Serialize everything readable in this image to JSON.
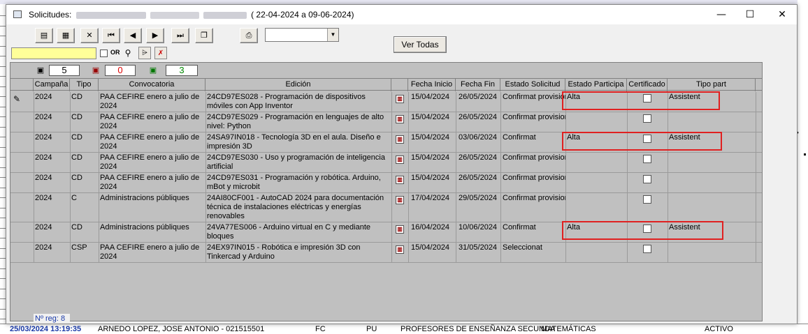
{
  "window": {
    "title_prefix": "Solicitudes:",
    "title_range": "( 22-04-2024 a  09-06-2024)",
    "minimize": "—",
    "maximize": "☐",
    "close": "✕"
  },
  "toolbar": {
    "icons": [
      "form-icon",
      "table-view-icon",
      "delete-icon",
      "first-record-icon",
      "previous-record-icon",
      "next-record-icon",
      "last-record-icon",
      "copy-icon",
      "print-icon"
    ],
    "ver_todas_label": "Ver Todas",
    "combo_value": "",
    "search_value": "",
    "or_label": "OR"
  },
  "counters": {
    "count1": "5",
    "count2": "0",
    "count3": "3"
  },
  "columns": [
    "Campaña",
    "Tipo",
    "Convocatoria",
    "Edición",
    "Fecha Inicio",
    "Fecha Fin",
    "Estado Solicitud",
    "Estado Participa",
    "Certificado",
    "Tipo part"
  ],
  "rows": [
    {
      "campana": "2024",
      "tipo": "CD",
      "convocatoria": "PAA CEFIRE enero a julio de 2024",
      "edicion": "24CD97ES028 - Programación de dispositivos móviles con App Inventor",
      "fecha_inicio": "15/04/2024",
      "fecha_fin": "26/05/2024",
      "estado_solicitud": "Confirmat provisional",
      "estado_participa": "Alta",
      "tipo_part": "Assistent"
    },
    {
      "campana": "2024",
      "tipo": "CD",
      "convocatoria": "PAA CEFIRE enero a julio de 2024",
      "edicion": "24CD97ES029 - Programación en lenguajes de alto nivel: Python",
      "fecha_inicio": "15/04/2024",
      "fecha_fin": "26/05/2024",
      "estado_solicitud": "Confirmat provisional",
      "estado_participa": "",
      "tipo_part": ""
    },
    {
      "campana": "2024",
      "tipo": "CD",
      "convocatoria": "PAA CEFIRE enero a julio de 2024",
      "edicion": "24SA97IN018 - Tecnología 3D en el aula. Diseño e impresión 3D",
      "fecha_inicio": "15/04/2024",
      "fecha_fin": "03/06/2024",
      "estado_solicitud": "Confirmat",
      "estado_participa": "Alta",
      "tipo_part": "Assistent"
    },
    {
      "campana": "2024",
      "tipo": "CD",
      "convocatoria": "PAA CEFIRE enero a julio de 2024",
      "edicion": "24CD97ES030 - Uso y programación de inteligencia artificial",
      "fecha_inicio": "15/04/2024",
      "fecha_fin": "26/05/2024",
      "estado_solicitud": "Confirmat provisional",
      "estado_participa": "",
      "tipo_part": ""
    },
    {
      "campana": "2024",
      "tipo": "CD",
      "convocatoria": "PAA CEFIRE enero a julio de 2024",
      "edicion": "24CD97ES031 - Programación y robótica. Arduino, mBot y microbit",
      "fecha_inicio": "15/04/2024",
      "fecha_fin": "26/05/2024",
      "estado_solicitud": "Confirmat provisional",
      "estado_participa": "",
      "tipo_part": ""
    },
    {
      "campana": "2024",
      "tipo": "C",
      "convocatoria": "Administracions públiques",
      "edicion": "24AI80CF001 - AutoCAD 2024 para documentación técnica de instalaciones eléctricas y energías renovables",
      "fecha_inicio": "17/04/2024",
      "fecha_fin": "29/05/2024",
      "estado_solicitud": "Confirmat provisional",
      "estado_participa": "",
      "tipo_part": ""
    },
    {
      "campana": "2024",
      "tipo": "CD",
      "convocatoria": "Administracions públiques",
      "edicion": "24VA77ES006 - Arduino virtual en C y mediante bloques",
      "fecha_inicio": "16/04/2024",
      "fecha_fin": "10/06/2024",
      "estado_solicitud": "Confirmat",
      "estado_participa": "Alta",
      "tipo_part": "Assistent"
    },
    {
      "campana": "2024",
      "tipo": "CSP",
      "convocatoria": "PAA CEFIRE enero a julio de 2024",
      "edicion": "24EX97IN015 - Robótica e impresión 3D con Tinkercad y Arduino",
      "fecha_inicio": "15/04/2024",
      "fecha_fin": "31/05/2024",
      "estado_solicitud": "Seleccionat",
      "estado_participa": "",
      "tipo_part": ""
    }
  ],
  "footer": {
    "nreg": "Nº reg: 8"
  },
  "background": {
    "bottom_datetime": "25/03/2024 13:19:35",
    "bottom_name": "ARNEDO LOPEZ, JOSE ANTONIO - 021515501",
    "bottom_fc": "FC",
    "bottom_pu": "PU",
    "bottom_desc": "PROFESORES DE ENSEÑANZA SECUNDA",
    "bottom_sub": "MATEMÁTICAS",
    "bottom_status": "ACTIVO"
  },
  "colors": {
    "highlight": "#e02020",
    "search_bg": "#ffff99",
    "grid_bg": "#c0c0c0",
    "nreg_text": "#1a3aa8"
  }
}
